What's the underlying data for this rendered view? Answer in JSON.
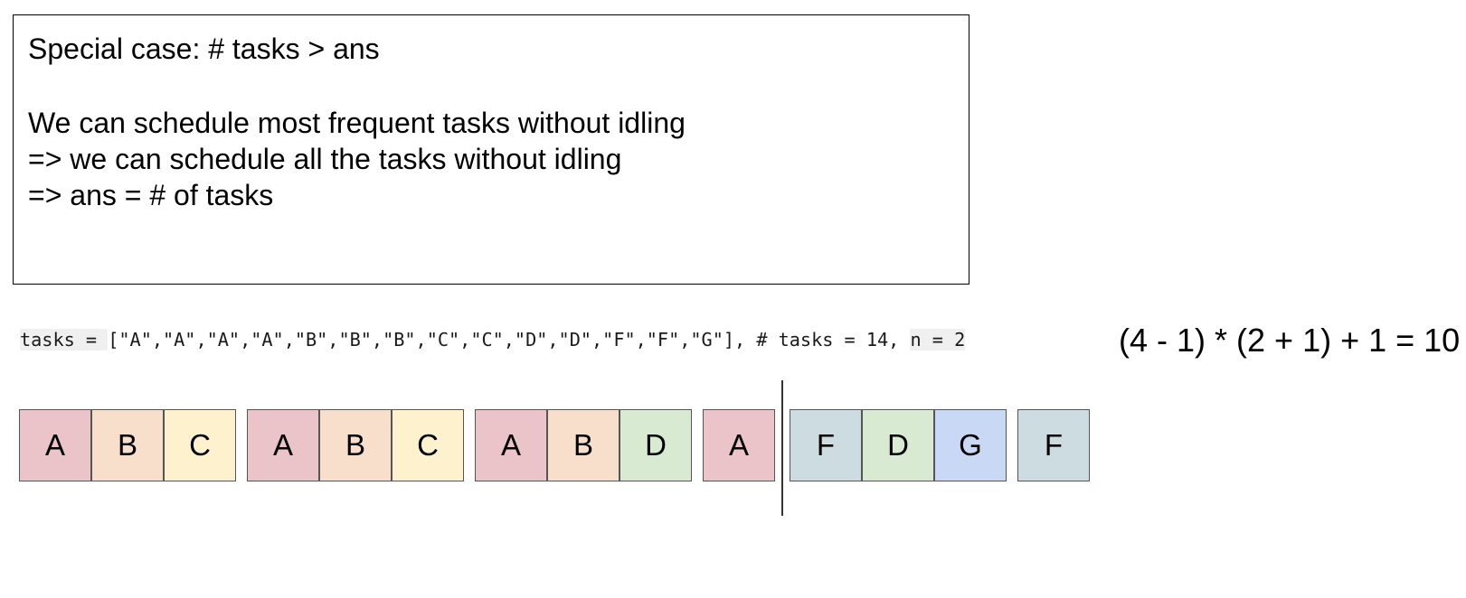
{
  "textbox": {
    "title": "Special case: # tasks > ans",
    "lines": [
      "We can schedule most frequent tasks without idling",
      "=> we can schedule all the tasks without idling",
      "=> ans = # of tasks"
    ]
  },
  "code_line": {
    "part1": "tasks = ",
    "part2": "[\"A\",\"A\",\"A\",\"A\",\"B\",\"B\",\"B\",\"C\",\"C\",\"D\",\"D\",\"F\",\"F\",\"G\"], # tasks = 14, ",
    "part3": " n = 2"
  },
  "formula": "(4 - 1) * (2 + 1) + 1 = 10",
  "colors": {
    "A": "#eac4c9",
    "B": "#f7dfcc",
    "C": "#fdf2cd",
    "D": "#d8ead2",
    "F": "#ccdce0",
    "G": "#c9d9f5"
  },
  "groups": [
    [
      "A",
      "B",
      "C"
    ],
    [
      "A",
      "B",
      "C"
    ],
    [
      "A",
      "B",
      "D"
    ],
    [
      "A"
    ],
    [
      "F",
      "D",
      "G"
    ],
    [
      "F"
    ]
  ]
}
